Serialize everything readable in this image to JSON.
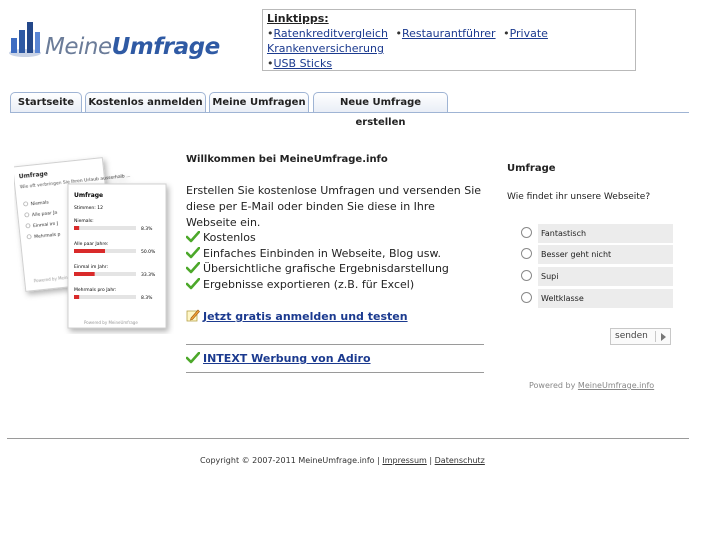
{
  "logo": {
    "part1": "Meine",
    "part2": "Umfrage"
  },
  "linktips": {
    "title": "Linktipps:",
    "links": [
      "Ratenkreditvergleich",
      "Restaurantführer",
      "Private Krankenversicherung",
      "USB Sticks"
    ]
  },
  "tabs": [
    "Startseite",
    "Kostenlos anmelden",
    "Meine Umfragen",
    "Neue Umfrage erstellen"
  ],
  "preview": {
    "back_title": "Umfrage",
    "back_question": "Wie oft verbringen Sie Ihren Urlaub ausserhalb ...",
    "back_options": [
      "Niemals",
      "Alle paar Ja",
      "Einmal im J",
      "Mehrmals p"
    ],
    "back_powered": "Powered by Mein",
    "front_title": "Umfrage",
    "front_votes": "Stimmen: 12",
    "front_results": [
      {
        "label": "Niemals:",
        "pct": "8.3%",
        "value": 8.3
      },
      {
        "label": "Alle paar Jahre:",
        "pct": "50.0%",
        "value": 50.0
      },
      {
        "label": "Einmal im Jahr:",
        "pct": "33.3%",
        "value": 33.3
      },
      {
        "label": "Mehrmals pro Jahr:",
        "pct": "8.3%",
        "value": 8.3
      }
    ],
    "front_powered": "Powered by MeineUmfrage"
  },
  "welcome": {
    "title": "Willkommen bei MeineUmfrage.info",
    "text": "Erstellen Sie kostenlose Umfragen und versenden Sie diese per E-Mail oder binden Sie diese in Ihre Webseite ein.",
    "features": [
      "Kostenlos",
      "Einfaches Einbinden in Webseite, Blog usw.",
      "Übersichtliche grafische Ergebnisdarstellung",
      "Ergebnisse exportieren (z.B. für Excel)"
    ],
    "signup_link": "Jetzt gratis anmelden und testen",
    "intext_link": "INTEXT Werbung von Adiro"
  },
  "poll": {
    "title": "Umfrage",
    "question": "Wie findet ihr unsere Webseite?",
    "options": [
      "Fantastisch",
      "Besser geht nicht",
      "Supi",
      "Weltklasse"
    ],
    "send_label": "senden",
    "powered_prefix": "Powered by",
    "powered_link": "MeineUmfrage.info"
  },
  "footer": {
    "copyright": "Copyright © 2007-2011 MeineUmfrage.info",
    "sep": "|",
    "impressum": "Impressum",
    "datenschutz": "Datenschutz"
  },
  "colors": {
    "accent": "#2f5aa4",
    "link": "#1b3a8f",
    "check": "#4ca82a",
    "bar": "#d92b2b"
  }
}
